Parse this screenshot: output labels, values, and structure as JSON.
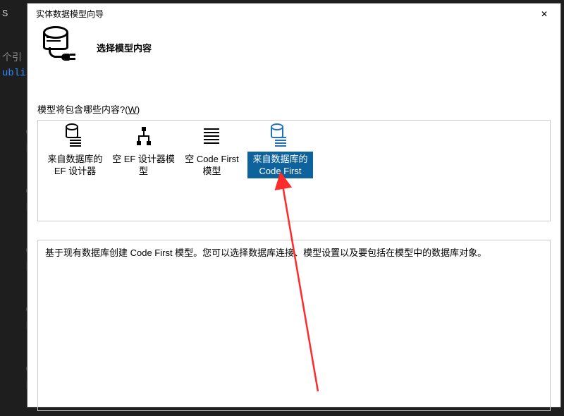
{
  "window": {
    "title": "实体数据模型向导"
  },
  "header": {
    "subtitle": "选择模型内容"
  },
  "question": {
    "prefix": "模型将包含哪些内容?(",
    "shortcut": "W",
    "suffix": ")"
  },
  "options": [
    {
      "label": "来自数据库的 EF 设计器",
      "selected": false
    },
    {
      "label": "空 EF 设计器模型",
      "selected": false
    },
    {
      "label": "空 Code First 模型",
      "selected": false
    },
    {
      "label": "来自数据库的 Code First",
      "selected": true
    }
  ],
  "description": "基于现有数据库创建 Code First 模型。您可以选择数据库连接、模型设置以及要包括在模型中的数据库对象。",
  "close_glyph": "✕"
}
